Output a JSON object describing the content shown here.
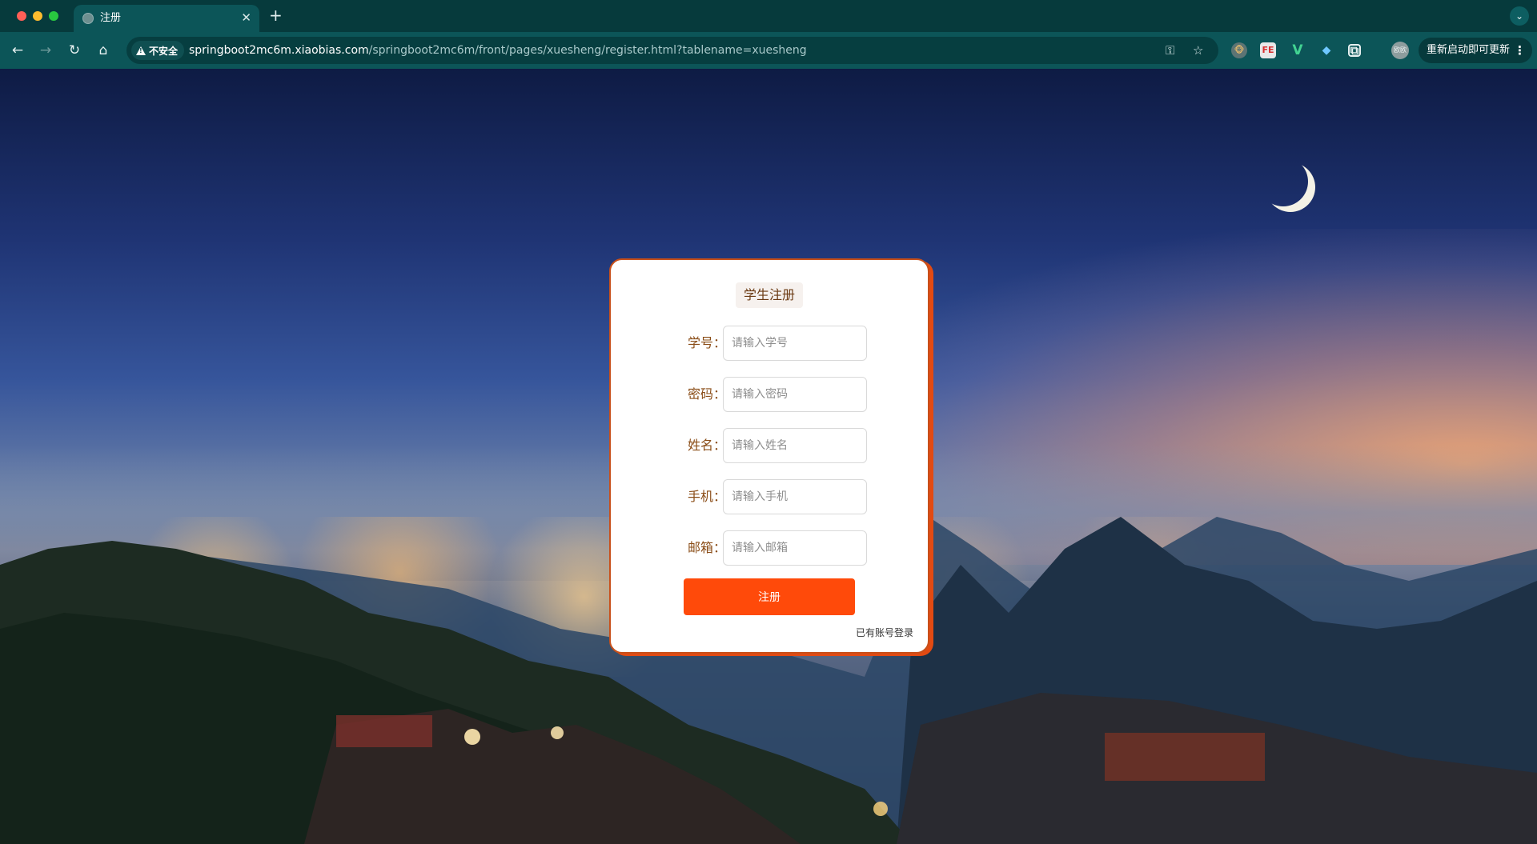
{
  "browser": {
    "tab_title": "注册",
    "tab_close": "✕",
    "new_tab": "+",
    "tab_menu": "⌄",
    "security_label": "不安全",
    "url_host": "springboot2mc6m.xiaobias.com",
    "url_path": "/springboot2mc6m/front/pages/xuesheng/register.html?tablename=xuesheng",
    "profile_label": "欧欧",
    "update_label": "重新启动即可更新",
    "update_more": "⋮",
    "nav": {
      "back": "←",
      "forward": "→",
      "reload": "↻",
      "home": "⌂"
    },
    "omnibox_icons": {
      "key": "⚿",
      "star": "☆"
    },
    "extensions": [
      "🐵",
      "FE",
      "V",
      "◆",
      "⧉"
    ]
  },
  "page": {
    "form_title": "学生注册",
    "fields": [
      {
        "label": "学号：",
        "placeholder": "请输入学号"
      },
      {
        "label": "密码：",
        "placeholder": "请输入密码"
      },
      {
        "label": "姓名：",
        "placeholder": "请输入姓名"
      },
      {
        "label": "手机：",
        "placeholder": "请输入手机"
      },
      {
        "label": "邮箱：",
        "placeholder": "请输入邮箱"
      }
    ],
    "submit_label": "注册",
    "login_link": "已有账号登录"
  },
  "colors": {
    "chrome_bg": "#063a3c",
    "toolbar_bg": "#0c5558",
    "card_border": "#c8501a",
    "button": "#ff4a0a",
    "label": "#8a4c16"
  }
}
